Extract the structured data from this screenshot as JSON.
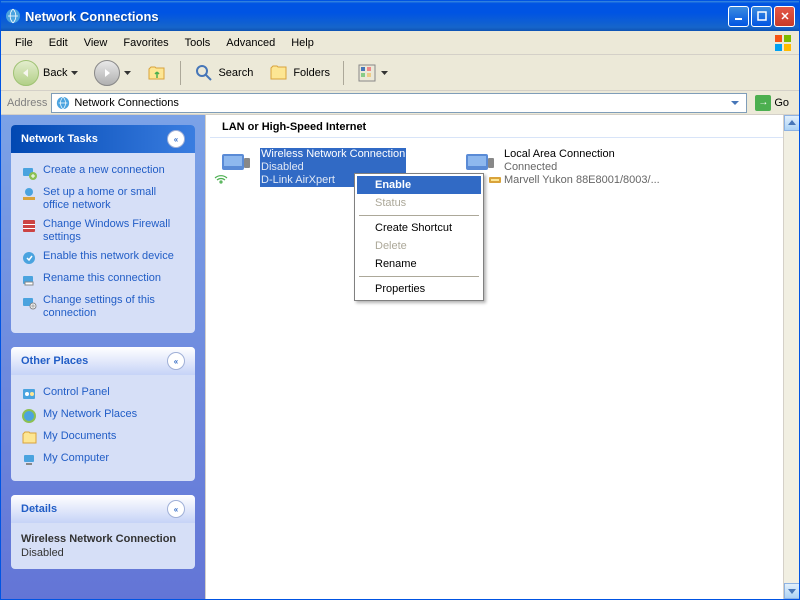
{
  "title": "Network Connections",
  "menu": [
    "File",
    "Edit",
    "View",
    "Favorites",
    "Tools",
    "Advanced",
    "Help"
  ],
  "toolbar": {
    "back": "Back",
    "search": "Search",
    "folders": "Folders"
  },
  "addressbar": {
    "label": "Address",
    "value": "Network Connections",
    "go": "Go"
  },
  "panels": {
    "tasks": {
      "title": "Network Tasks",
      "links": [
        "Create a new connection",
        "Set up a home or small office network",
        "Change Windows Firewall settings",
        "Enable this network device",
        "Rename this connection",
        "Change settings of this connection"
      ]
    },
    "places": {
      "title": "Other Places",
      "links": [
        "Control Panel",
        "My Network Places",
        "My Documents",
        "My Computer"
      ]
    },
    "details": {
      "title": "Details",
      "name": "Wireless Network Connection",
      "status": "Disabled"
    }
  },
  "main": {
    "section": "LAN or High-Speed Internet",
    "connections": [
      {
        "name": "Wireless Network Connection",
        "status": "Disabled",
        "adapter": "D-Link AirXpert",
        "selected": true
      },
      {
        "name": "Local Area Connection",
        "status": "Connected",
        "adapter": "Marvell Yukon 88E8001/8003/...",
        "selected": false
      }
    ]
  },
  "context_menu": {
    "items": [
      {
        "label": "Enable",
        "highlight": true,
        "disabled": false
      },
      {
        "label": "Status",
        "highlight": false,
        "disabled": true
      },
      {
        "type": "sep"
      },
      {
        "label": "Create Shortcut",
        "highlight": false,
        "disabled": false
      },
      {
        "label": "Delete",
        "highlight": false,
        "disabled": true
      },
      {
        "label": "Rename",
        "highlight": false,
        "disabled": false
      },
      {
        "type": "sep"
      },
      {
        "label": "Properties",
        "highlight": false,
        "disabled": false
      }
    ]
  }
}
